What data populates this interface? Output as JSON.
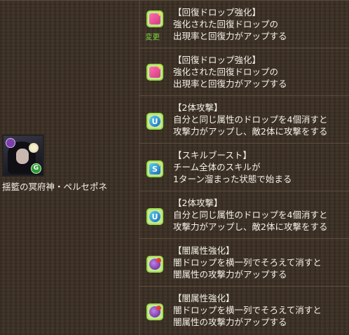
{
  "monster": {
    "name": "揺籃の冥府神・ペルセポネ",
    "icon_main": "persephone-portrait-icon",
    "icon_attr": "dark-attribute-icon",
    "icon_sub_attr": "G",
    "colors": {
      "dark_attr": "#7a3fa8",
      "green_badge": "#2f9a38"
    }
  },
  "awakenings": [
    {
      "icon": "heal-orb-enhance-icon",
      "change_label": "変更",
      "title": "【回復ドロップ強化】",
      "line1": "強化された回復ドロップの",
      "line2": "出現率と回復力がアップする"
    },
    {
      "icon": "heal-orb-enhance-icon",
      "title": "【回復ドロップ強化】",
      "line1": "強化された回復ドロップの",
      "line2": "出現率と回復力がアップする"
    },
    {
      "icon": "two-way-attack-icon",
      "title": "【2体攻撃】",
      "line1": "自分と同じ属性のドロップを4個消すと",
      "line2": "攻撃力がアップし、敵2体に攻撃をする"
    },
    {
      "icon": "skill-boost-icon",
      "title": "【スキルブースト】",
      "line1": "チーム全体のスキルが",
      "line2": "1ターン溜まった状態で始まる"
    },
    {
      "icon": "two-way-attack-icon",
      "title": "【2体攻撃】",
      "line1": "自分と同じ属性のドロップを4個消すと",
      "line2": "攻撃力がアップし、敵2体に攻撃をする"
    },
    {
      "icon": "dark-row-enhance-icon",
      "title": "【闇属性強化】",
      "line1": "闇ドロップを横一列でそろえて消すと",
      "line2": "闇属性の攻撃力がアップする"
    },
    {
      "icon": "dark-row-enhance-icon",
      "title": "【闇属性強化】",
      "line1": "闇ドロップを横一列でそろえて消すと",
      "line2": "闇属性の攻撃力がアップする"
    }
  ]
}
